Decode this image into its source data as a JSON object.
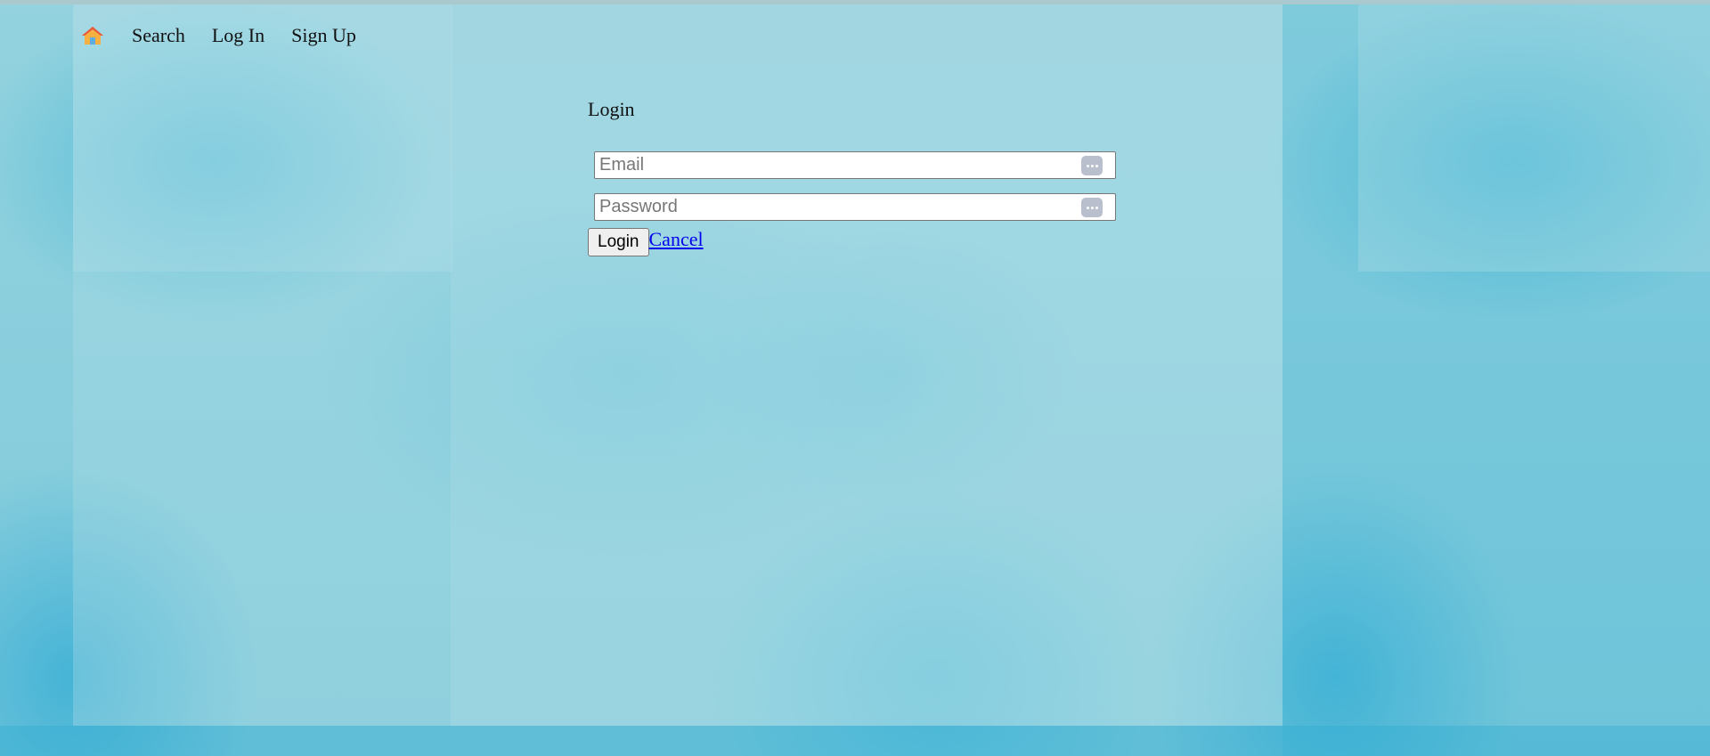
{
  "nav": {
    "home_icon": "home-icon",
    "items": [
      {
        "label": "Search"
      },
      {
        "label": "Log In"
      },
      {
        "label": "Sign Up"
      }
    ]
  },
  "form": {
    "title": "Login",
    "email_placeholder": "Email",
    "password_placeholder": "Password",
    "autofill_icon": "more-dots-icon",
    "login_button": "Login",
    "cancel_link": "Cancel"
  },
  "colors": {
    "background": "#8ccfdc",
    "link": "#0000ee",
    "home_icon_roof": "#e8573b",
    "home_icon_body": "#f5b041"
  }
}
